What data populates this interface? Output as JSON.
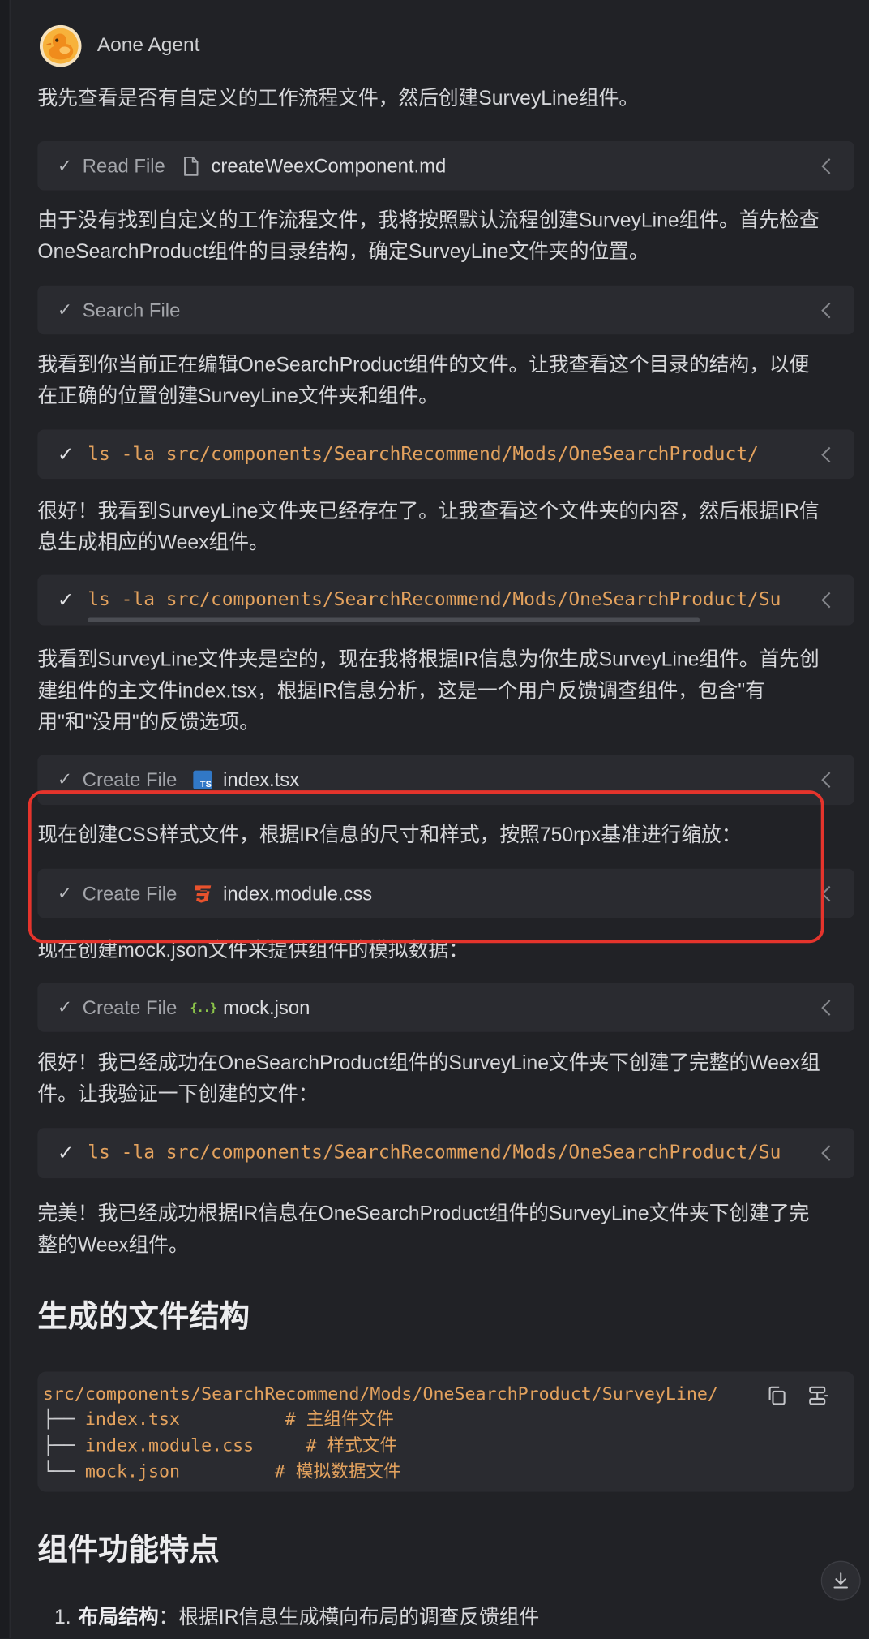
{
  "header": {
    "agent_name": "Aone Agent",
    "avatar_icon": "agent-avatar-icon"
  },
  "messages": [
    [
      "我先查看是否有自定义的工作流程文件，然后创建SurveyLine组件。"
    ],
    [
      "由于没有找到自定义的工作流程文件，我将按照默认流程创建SurveyLine组件。首先检查",
      "OneSearchProduct组件的目录结构，确定SurveyLine文件夹的位置。"
    ],
    [
      "我看到你当前正在编辑OneSearchProduct组件的文件。让我查看这个目录的结构，以便",
      "在正确的位置创建SurveyLine文件夹和组件。"
    ],
    [
      "很好！我看到SurveyLine文件夹已经存在了。让我查看这个文件夹的内容，然后根据IR信",
      "息生成相应的Weex组件。"
    ],
    [
      "我看到SurveyLine文件夹是空的，现在我将根据IR信息为你生成SurveyLine组件。首先创",
      "建组件的主文件index.tsx，根据IR信息分析，这是一个用户反馈调查组件，包含\"有",
      "用\"和\"没用\"的反馈选项。"
    ],
    [
      "现在创建CSS样式文件，根据IR信息的尺寸和样式，按照750rpx基准进行缩放："
    ],
    [
      "现在创建mock.json文件来提供组件的模拟数据："
    ],
    [
      "很好！我已经成功在OneSearchProduct组件的SurveyLine文件夹下创建了完整的Weex组",
      "件。让我验证一下创建的文件："
    ],
    [
      "完美！我已经成功根据IR信息在OneSearchProduct组件的SurveyLine文件夹下创建了完",
      "整的Weex组件。"
    ]
  ],
  "tool_calls": [
    {
      "check": "✓",
      "action": "Read File",
      "icon": "file-icon",
      "target": "createWeexComponent.md"
    },
    {
      "check": "✓",
      "action": "Search File"
    },
    {
      "check": "✓",
      "action": "Create File",
      "icon": "typescript-icon",
      "icon_text": "TS",
      "target": "index.tsx"
    },
    {
      "check": "✓",
      "action": "Create File",
      "icon": "css3-icon",
      "target": "index.module.css"
    },
    {
      "check": "✓",
      "action": "Create File",
      "icon": "json-icon",
      "icon_text": "{..}",
      "target": "mock.json"
    }
  ],
  "commands": [
    {
      "check": "✓",
      "command": "ls -la src/components/SearchRecommend/Mods/OneSearchProduct/"
    },
    {
      "check": "✓",
      "command": "ls -la src/components/SearchRecommend/Mods/OneSearchProduct/Su"
    },
    {
      "check": "✓",
      "command": "ls -la src/components/SearchRecommend/Mods/OneSearchProduct/Su"
    }
  ],
  "sections": {
    "file_structure": {
      "heading": "生成的文件结构",
      "code": {
        "root": "src/components/SearchRecommend/Mods/OneSearchProduct/SurveyLine/",
        "entries": [
          {
            "branch": "├──",
            "name": "index.tsx",
            "comment": "# 主组件文件"
          },
          {
            "branch": "├──",
            "name": "index.module.css",
            "comment": "# 样式文件"
          },
          {
            "branch": "└──",
            "name": "mock.json",
            "comment": "# 模拟数据文件"
          }
        ],
        "copy_icon": "copy-icon",
        "insert_icon": "insert-code-icon"
      }
    },
    "features": {
      "heading": "组件功能特点",
      "items": [
        {
          "number": "1.",
          "title": "布局结构",
          "text": "：根据IR信息生成横向布局的调查反馈组件"
        }
      ]
    }
  },
  "scroll_button": {
    "icon": "scroll-to-bottom-icon"
  },
  "colors": {
    "background": "#212226",
    "card": "#2a2b30",
    "command_orange": "#e3a25e",
    "highlight_red": "#e5342c",
    "typescript_blue": "#3178c6",
    "css_orange": "#e8522d",
    "json_green": "#8bc34a"
  }
}
